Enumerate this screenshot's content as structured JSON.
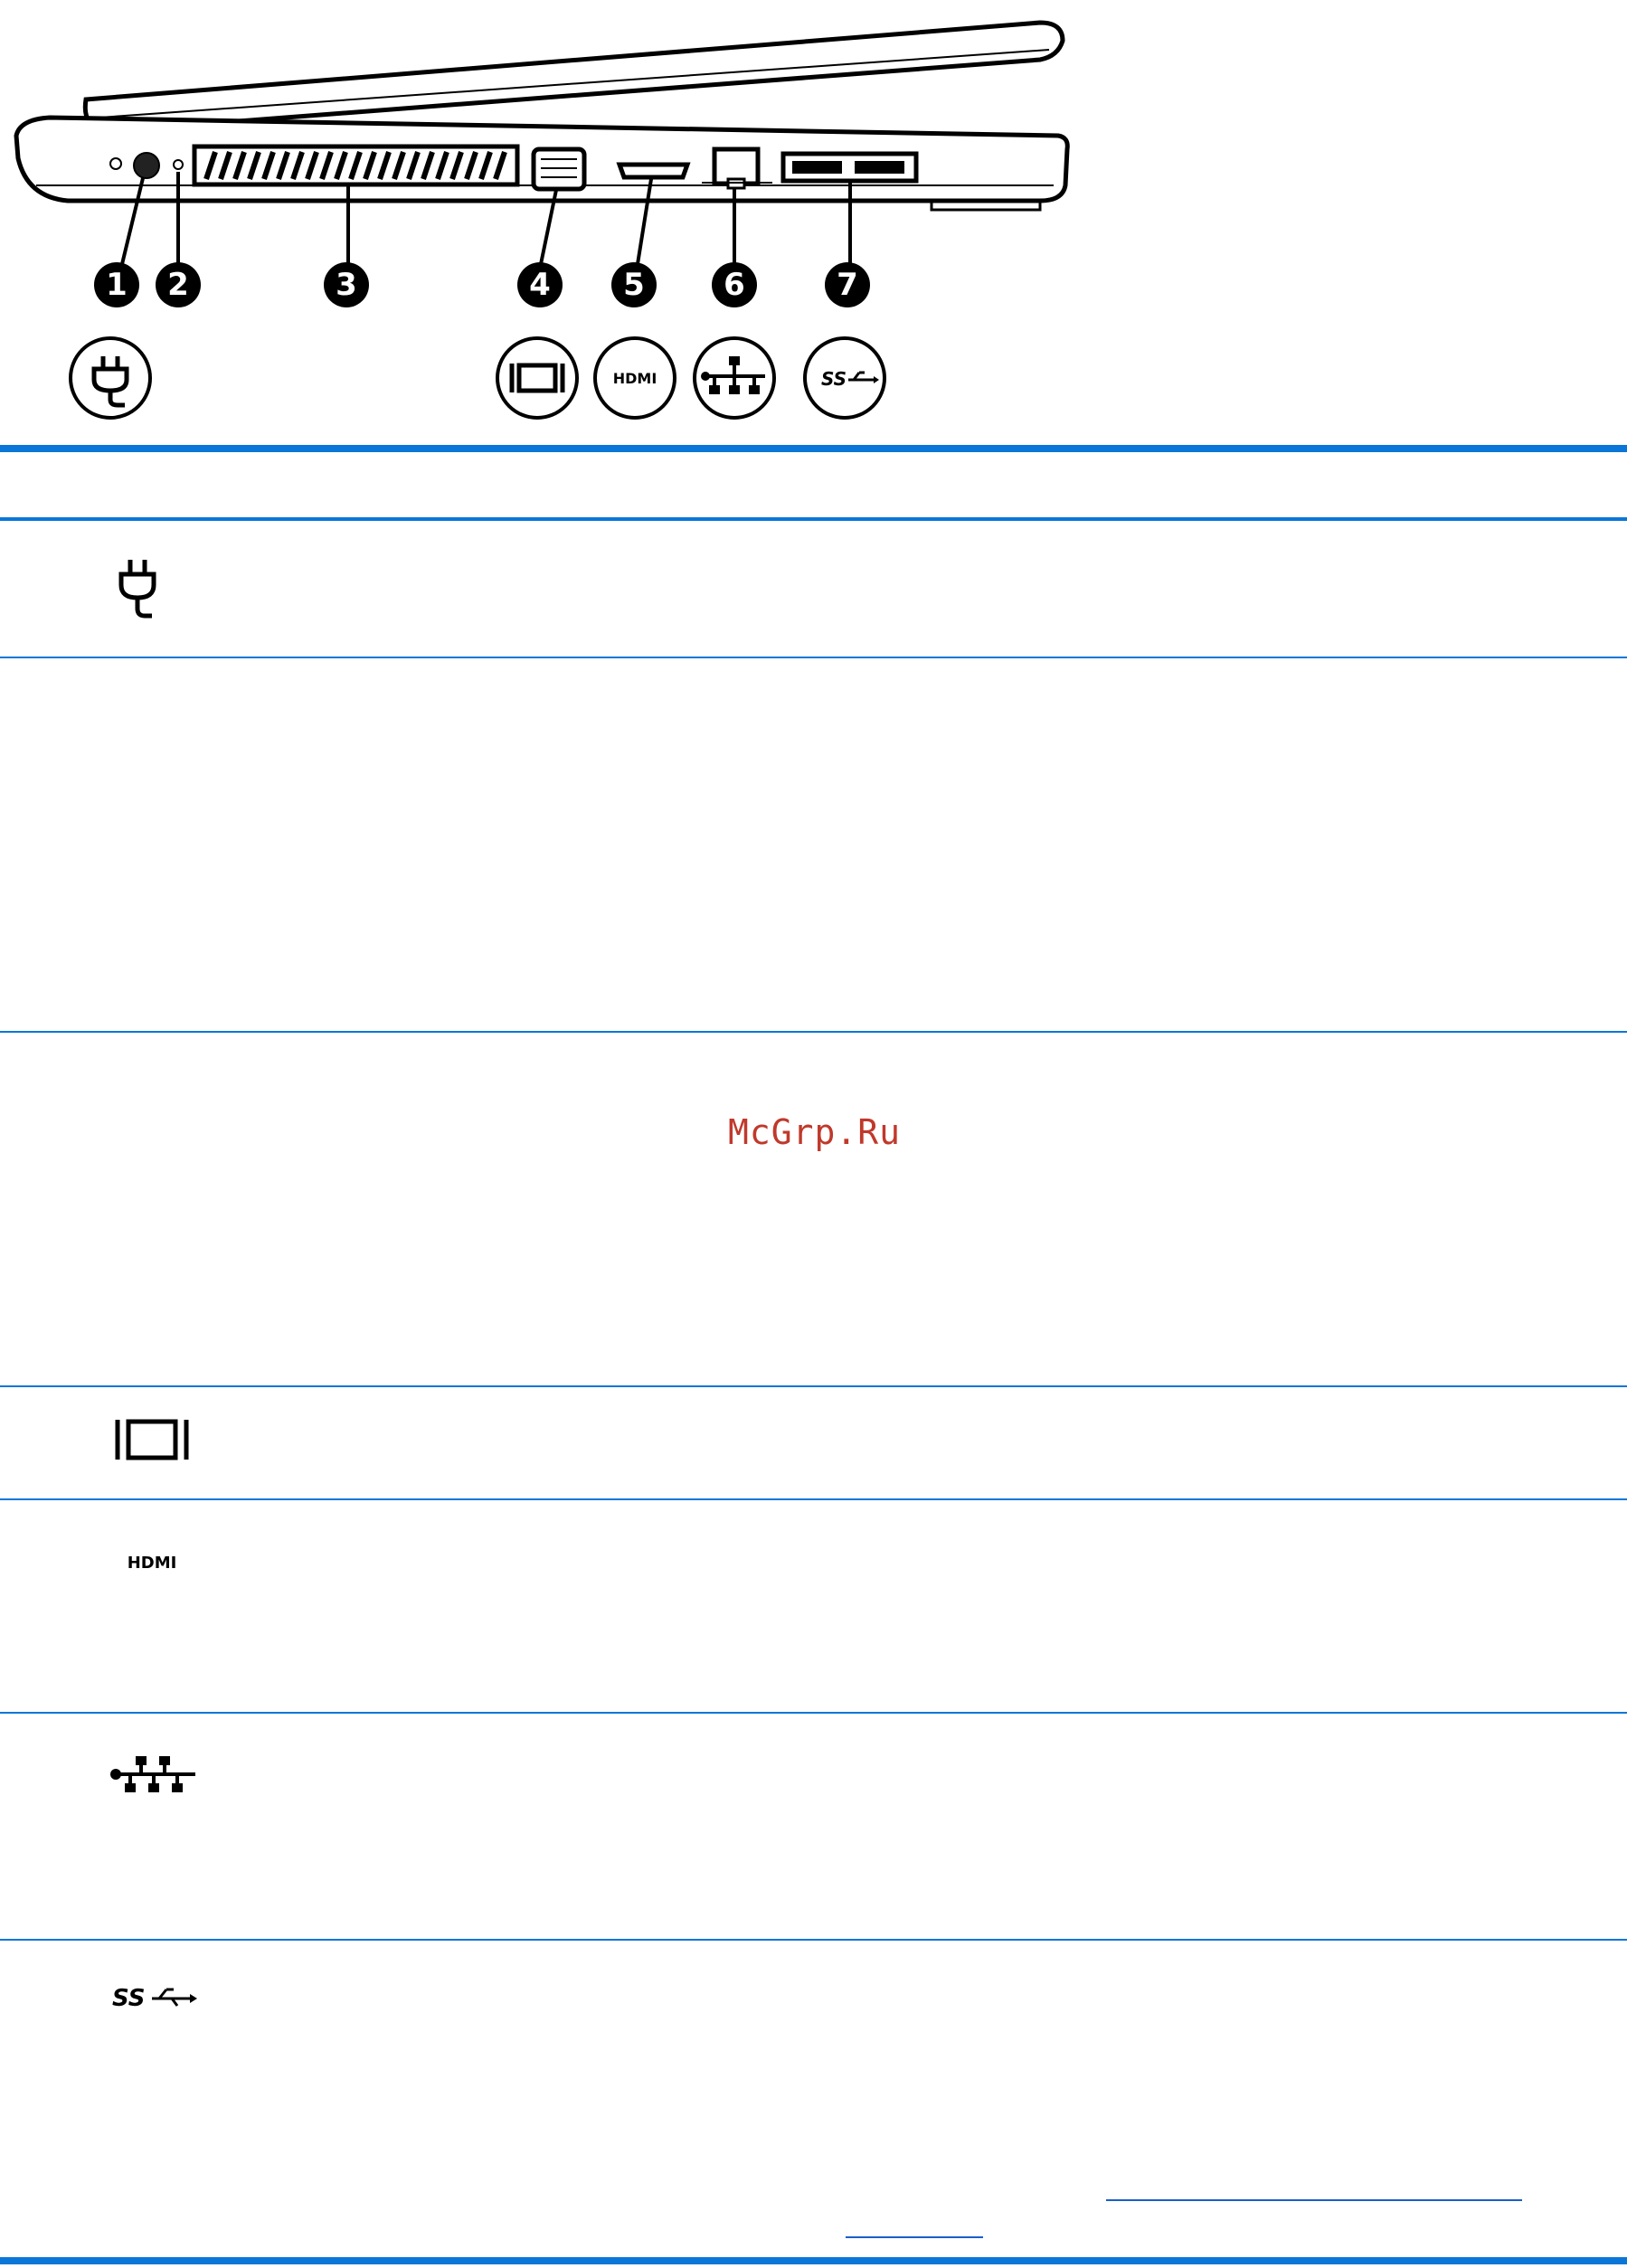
{
  "watermark": "McGrp.Ru",
  "callouts": [
    "1",
    "2",
    "3",
    "4",
    "5",
    "6",
    "7"
  ],
  "icons": {
    "power": "power-plug-icon",
    "display": "external-monitor-icon",
    "hdmi": "hdmi-icon",
    "network": "rj45-network-icon",
    "usb": "usb-superspeed-icon"
  },
  "colors": {
    "rule": "#0a76d8",
    "watermark": "#c0392b",
    "link": "#1a5fc9"
  }
}
